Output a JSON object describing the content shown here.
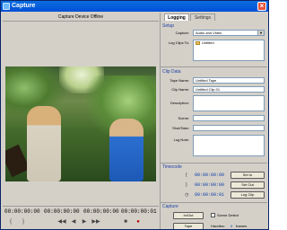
{
  "window": {
    "title": "Capture",
    "close_glyph": "×"
  },
  "preview": {
    "status": "Capture Device Offline"
  },
  "transport": {
    "timecodes": [
      "00:00:00:00",
      "00:00:00:00",
      "00:00:00:00",
      "00:00:00:01"
    ],
    "buttons": [
      "{",
      "}",
      "◀◀",
      "◀",
      "▶",
      "▶▶",
      "■",
      "●"
    ]
  },
  "tabs": [
    {
      "label": "Logging",
      "active": true
    },
    {
      "label": "Settings",
      "active": false
    }
  ],
  "setup": {
    "title": "Setup",
    "capture_label": "Capture:",
    "capture_value": "Audio and Video",
    "log_clips_label": "Log Clips To:",
    "log_clips_value": "Untitled"
  },
  "clip_data": {
    "title": "Clip Data",
    "tape_name_label": "Tape Name:",
    "tape_name_value": "Untitled Tape",
    "clip_name_label": "Clip Name:",
    "clip_name_value": "Untitled Clip 01",
    "description_label": "Description:",
    "scene_label": "Scene:",
    "shot_take_label": "Shot/Take:",
    "log_note_label": "Log Note:"
  },
  "timecode": {
    "title": "Timecode",
    "in_value": "00:00:00:00",
    "out_value": "00:00:00:00",
    "duration_value": "00:00:00:01",
    "set_in_label": "Set In",
    "set_out_label": "Set Out",
    "log_clip_label": "Log Clip"
  },
  "capture": {
    "title": "Capture",
    "in_out_label": "In/Out",
    "tape_label": "Tape",
    "scene_detect_label": "Scene Detect",
    "handles_label": "Handles:",
    "handles_value": "0",
    "handles_unit": "frames"
  }
}
